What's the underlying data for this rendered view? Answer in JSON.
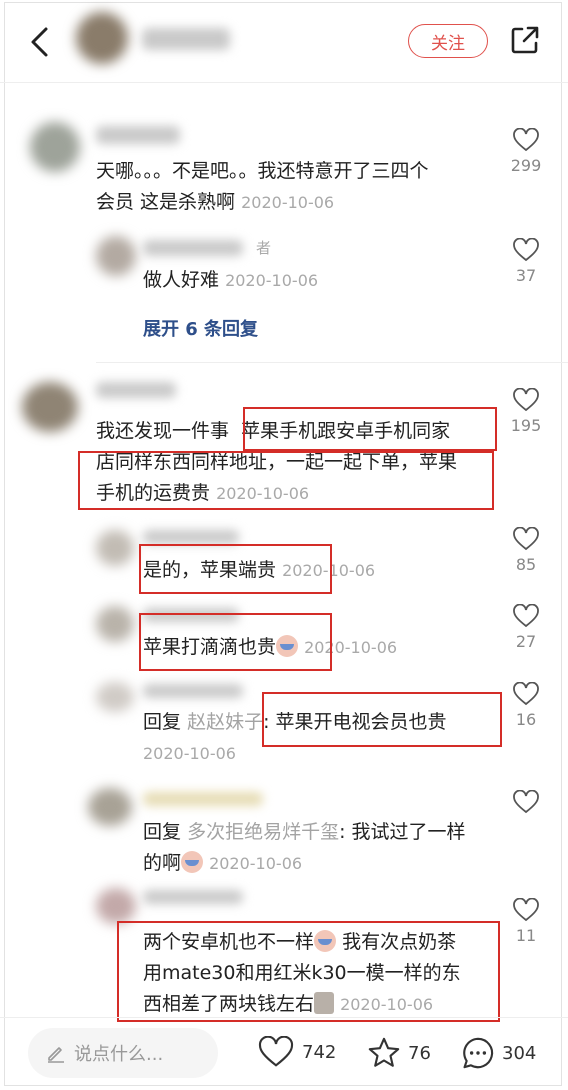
{
  "header": {
    "follow_label": "关注"
  },
  "colors": {
    "accent": "#e0514c",
    "annotation_red": "#d42d28",
    "muted": "#a9a9a9",
    "link_blue": "#2e4f8a"
  },
  "comments": [
    {
      "text_line1": "天哪。。。不是吧。。我还特意开了三四个",
      "text_line2": "会员 这是杀熟啊",
      "date": "2020-10-06",
      "likes": "299",
      "author_tag": "者",
      "replies": [
        {
          "text": "做人好难",
          "date": "2020-10-06",
          "likes": "37"
        }
      ],
      "expand_label": "展开 6 条回复"
    },
    {
      "text_line1a": "我还发现一件事",
      "text_line1b": "苹果手机跟安卓手机同家",
      "text_line2": "店同样东西同样地址，一起一起下单，苹果",
      "text_line3": "手机的运费贵",
      "date": "2020-10-06",
      "likes": "195",
      "replies": [
        {
          "text": "是的，苹果端贵",
          "date": "2020-10-06",
          "likes": "85"
        },
        {
          "text": "苹果打滴滴也贵",
          "date": "2020-10-06",
          "likes": "27"
        },
        {
          "reply_prefix": "回复",
          "reply_to": "赵赵妹子",
          "text": ": 苹果开电视会员也贵",
          "date": "2020-10-06",
          "likes": "16"
        },
        {
          "reply_prefix": "回复",
          "reply_to": "多次拒绝易烊千玺",
          "text": ": 我试过了一样",
          "text_line2": "的啊",
          "date": "2020-10-06",
          "likes": ""
        },
        {
          "text_line1a": "两个安卓机也不一样",
          "text_line1b": "我有次点奶茶",
          "text_line2": "用mate30和用红米k30一模一样的东",
          "text_line3": "西相差了两块钱左右",
          "date": "2020-10-06",
          "likes": "11"
        }
      ]
    }
  ],
  "bottom_bar": {
    "input_placeholder": "说点什么...",
    "likes": "742",
    "collects": "76",
    "comments": "304"
  }
}
